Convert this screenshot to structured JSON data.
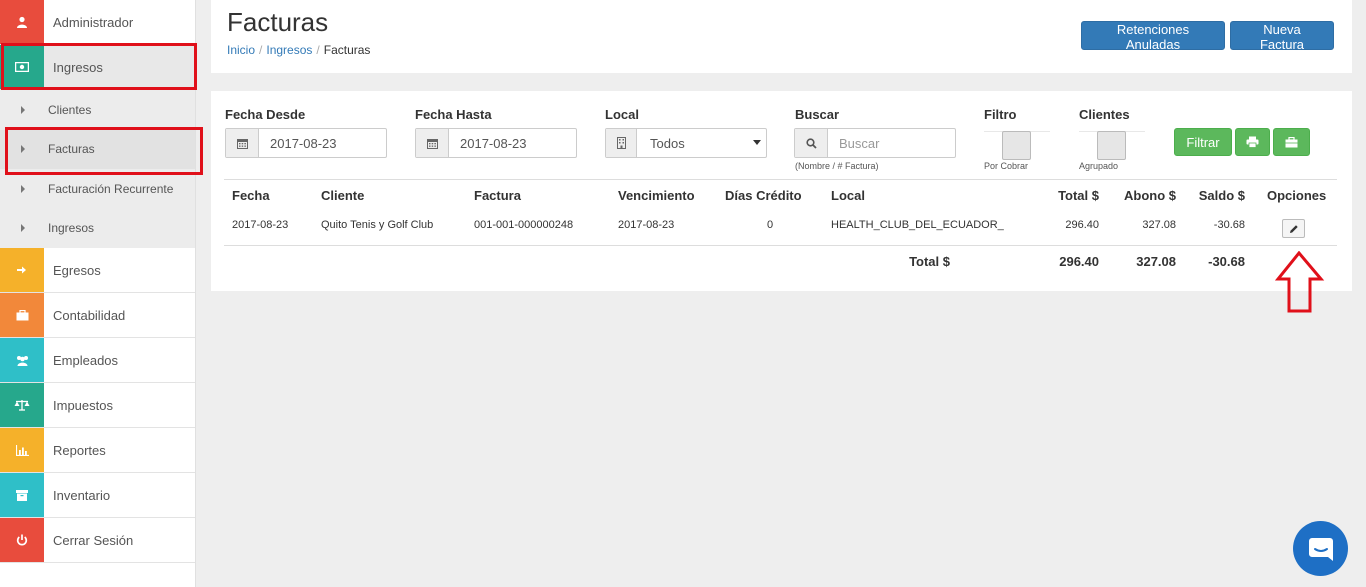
{
  "sidebar": {
    "items": [
      {
        "label": "Administrador",
        "icon": "user-icon",
        "color": "#e84c3d"
      },
      {
        "label": "Ingresos",
        "icon": "money-icon",
        "color": "#26a88c"
      },
      {
        "label": "Egresos",
        "icon": "sign-in-icon",
        "color": "#f5b12a"
      },
      {
        "label": "Contabilidad",
        "icon": "briefcase-icon",
        "color": "#f2883a"
      },
      {
        "label": "Empleados",
        "icon": "users-icon",
        "color": "#2fbfc8"
      },
      {
        "label": "Impuestos",
        "icon": "balance-scale-icon",
        "color": "#26a88c"
      },
      {
        "label": "Reportes",
        "icon": "bar-chart-icon",
        "color": "#f5b12a"
      },
      {
        "label": "Inventario",
        "icon": "archive-icon",
        "color": "#2fbfc8"
      },
      {
        "label": "Cerrar Sesión",
        "icon": "power-icon",
        "color": "#e84c3d"
      }
    ],
    "subitems": [
      {
        "label": "Clientes"
      },
      {
        "label": "Facturas"
      },
      {
        "label": "Facturación Recurrente"
      },
      {
        "label": "Ingresos"
      }
    ]
  },
  "header": {
    "title": "Facturas",
    "breadcrumb": [
      "Inicio",
      "Ingresos",
      "Facturas"
    ],
    "btn_retenciones": "Retenciones Anuladas",
    "btn_nueva": "Nueva Factura"
  },
  "filters": {
    "fecha_desde_label": "Fecha Desde",
    "fecha_desde_value": "2017-08-23",
    "fecha_hasta_label": "Fecha Hasta",
    "fecha_hasta_value": "2017-08-23",
    "local_label": "Local",
    "local_value": "Todos",
    "buscar_label": "Buscar",
    "buscar_placeholder": "Buscar",
    "buscar_hint": "(Nombre / # Factura)",
    "filtro_label": "Filtro",
    "filtro_hint": "Por Cobrar",
    "clientes_label": "Clientes",
    "clientes_hint": "Agrupado",
    "filtrar_btn": "Filtrar"
  },
  "table": {
    "headers": {
      "fecha": "Fecha",
      "cliente": "Cliente",
      "factura": "Factura",
      "vencimiento": "Vencimiento",
      "dias": "Días Crédito",
      "local": "Local",
      "total": "Total $",
      "abono": "Abono $",
      "saldo": "Saldo $",
      "opciones": "Opciones"
    },
    "row": {
      "fecha": "2017-08-23",
      "cliente": "Quito Tenis y Golf Club",
      "factura": "001-001-000000248",
      "vencimiento": "2017-08-23",
      "dias": "0",
      "local": "HEALTH_CLUB_DEL_ECUADOR_",
      "total": "296.40",
      "abono": "327.08",
      "saldo": "-30.68"
    },
    "footer": {
      "label": "Total $",
      "total": "296.40",
      "abono": "327.08",
      "saldo": "-30.68"
    }
  },
  "colors": {
    "primary": "#337ab7",
    "success": "#5cb85c",
    "highlight": "#e0101a",
    "chat": "#1e6fc5"
  }
}
